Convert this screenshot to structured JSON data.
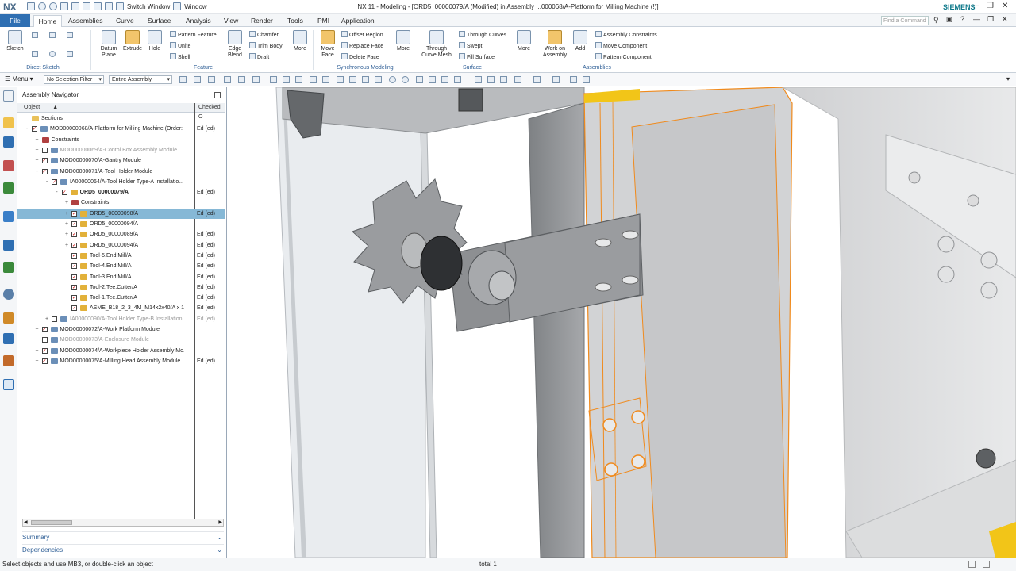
{
  "app": {
    "logo": "NX",
    "title": "NX 11 - Modeling - [ORD5_00000079/A (Modified)  in Assembly ...000068/A-Platform for Milling Machine  (!)]",
    "brand": "SIEMENS",
    "switch_window": "Switch Window",
    "window": "Window",
    "find_command_placeholder": "Find a Command"
  },
  "menu": {
    "tabs": [
      "File",
      "Home",
      "Assemblies",
      "Curve",
      "Surface",
      "Analysis",
      "View",
      "Render",
      "Tools",
      "PMI",
      "Application"
    ],
    "active": "Home"
  },
  "ribbon": {
    "direct_sketch": {
      "sketch": "Sketch",
      "label": "Direct Sketch"
    },
    "feature": {
      "datum_plane": "Datum Plane",
      "extrude": "Extrude",
      "hole": "Hole",
      "pattern_feature": "Pattern Feature",
      "unite": "Unite",
      "shell": "Shell",
      "edge_blend": "Edge Blend",
      "chamfer": "Chamfer",
      "trim_body": "Trim Body",
      "draft": "Draft",
      "more": "More",
      "label": "Feature"
    },
    "sync": {
      "move_face": "Move Face",
      "offset_region": "Offset Region",
      "replace_face": "Replace Face",
      "delete_face": "Delete Face",
      "more": "More",
      "label": "Synchronous Modeling"
    },
    "surface": {
      "through_curve_mesh": "Through Curve Mesh",
      "through_curves": "Through Curves",
      "swept": "Swept",
      "fill_surface": "Fill Surface",
      "more": "More",
      "label": "Surface"
    },
    "assemblies": {
      "work_on_assembly": "Work on Assembly",
      "add": "Add",
      "assembly_constraints": "Assembly Constraints",
      "move_component": "Move Component",
      "pattern_component": "Pattern Component",
      "label": "Assemblies"
    }
  },
  "selection_bar": {
    "menu": "Menu",
    "filter": "No Selection Filter",
    "scope": "Entire Assembly"
  },
  "navigator": {
    "title": "Assembly Navigator",
    "col_object": "Object",
    "col_checked": "Checked O",
    "rows": [
      {
        "label": "Sections",
        "level": 0,
        "exp": "",
        "cb": false,
        "icon": "folder",
        "checked": "",
        "dim": false,
        "bold": false
      },
      {
        "label": "MOD00000068/A-Platform for Milling Machine (Order: ...",
        "level": 0,
        "exp": "-",
        "cb": true,
        "icon": "asm",
        "checked": "Ed (ed)",
        "dim": false,
        "bold": false
      },
      {
        "label": "Constraints",
        "level": 1,
        "exp": "+",
        "cb": false,
        "icon": "constraint",
        "checked": "",
        "dim": false,
        "bold": false
      },
      {
        "label": "MOD00000069/A-Contol Box Assembly Module",
        "level": 1,
        "exp": "+",
        "cb": "empty",
        "icon": "asm",
        "checked": "",
        "dim": true,
        "bold": false
      },
      {
        "label": "MOD00000070/A-Gantry Module",
        "level": 1,
        "exp": "+",
        "cb": true,
        "icon": "asm",
        "checked": "",
        "dim": false,
        "bold": false
      },
      {
        "label": "MOD00000071/A-Tool Holder Module",
        "level": 1,
        "exp": "-",
        "cb": true,
        "icon": "asm",
        "checked": "",
        "dim": false,
        "bold": false
      },
      {
        "label": "IA00000064/A-Tool Holder Type-A Installatio...",
        "level": 2,
        "exp": "-",
        "cb": true,
        "icon": "asm",
        "checked": "",
        "dim": false,
        "bold": false
      },
      {
        "label": "ORD5_00000079/A",
        "level": 3,
        "exp": "-",
        "cb": true,
        "icon": "part",
        "checked": "Ed (ed)",
        "dim": false,
        "bold": true
      },
      {
        "label": "Constraints",
        "level": 4,
        "exp": "+",
        "cb": false,
        "icon": "constraint",
        "checked": "",
        "dim": false,
        "bold": false
      },
      {
        "label": "ORD5_00000098/A",
        "level": 4,
        "exp": "+",
        "cb": true,
        "icon": "part",
        "checked": "Ed (ed)",
        "dim": false,
        "bold": false,
        "sel": true
      },
      {
        "label": "ORD5_00000094/A",
        "level": 4,
        "exp": "+",
        "cb": true,
        "icon": "part",
        "checked": "",
        "dim": false,
        "bold": false
      },
      {
        "label": "ORD5_00000089/A",
        "level": 4,
        "exp": "+",
        "cb": true,
        "icon": "part",
        "checked": "Ed (ed)",
        "dim": false,
        "bold": false
      },
      {
        "label": "ORD5_00000094/A",
        "level": 4,
        "exp": "+",
        "cb": true,
        "icon": "part",
        "checked": "Ed (ed)",
        "dim": false,
        "bold": false
      },
      {
        "label": "Tool-5.End.Mill/A",
        "level": 4,
        "exp": "",
        "cb": true,
        "icon": "part",
        "checked": "Ed (ed)",
        "dim": false,
        "bold": false
      },
      {
        "label": "Tool-4.End.Mill/A",
        "level": 4,
        "exp": "",
        "cb": true,
        "icon": "part",
        "checked": "Ed (ed)",
        "dim": false,
        "bold": false
      },
      {
        "label": "Tool-3.End.Mill/A",
        "level": 4,
        "exp": "",
        "cb": true,
        "icon": "part",
        "checked": "Ed (ed)",
        "dim": false,
        "bold": false
      },
      {
        "label": "Tool-2.Tee.Cutter/A",
        "level": 4,
        "exp": "",
        "cb": true,
        "icon": "part",
        "checked": "Ed (ed)",
        "dim": false,
        "bold": false
      },
      {
        "label": "Tool-1.Tee.Cutter/A",
        "level": 4,
        "exp": "",
        "cb": true,
        "icon": "part",
        "checked": "Ed (ed)",
        "dim": false,
        "bold": false
      },
      {
        "label": "ASME_B18_2_3_4M_M14x2x40/A x 12",
        "level": 4,
        "exp": "",
        "cb": true,
        "icon": "part",
        "checked": "Ed (ed)",
        "dim": false,
        "bold": false
      },
      {
        "label": "IA00000090/A-Tool Holder Type-B Installation...",
        "level": 2,
        "exp": "+",
        "cb": "empty",
        "icon": "asm",
        "checked": "Ed (ed)",
        "dim": true,
        "bold": false
      },
      {
        "label": "MOD00000072/A-Work Platform Module",
        "level": 1,
        "exp": "+",
        "cb": true,
        "icon": "asm",
        "checked": "",
        "dim": false,
        "bold": false
      },
      {
        "label": "MOD00000073/A-Enclosure Module",
        "level": 1,
        "exp": "+",
        "cb": "empty",
        "icon": "asm",
        "checked": "",
        "dim": true,
        "bold": false
      },
      {
        "label": "MOD00000074/A-Workpiece Holder Assembly Mo...",
        "level": 1,
        "exp": "+",
        "cb": true,
        "icon": "asm",
        "checked": "",
        "dim": false,
        "bold": false
      },
      {
        "label": "MOD00000075/A-Milling Head Assembly Module",
        "level": 1,
        "exp": "+",
        "cb": true,
        "icon": "asm",
        "checked": "Ed (ed)",
        "dim": false,
        "bold": false
      }
    ],
    "summary": "Summary",
    "dependencies": "Dependencies"
  },
  "status": {
    "left": "Select objects and use MB3, or double-click an object",
    "center": "total 1"
  },
  "colors": {
    "accent": "#2f6fb2",
    "selection": "#86b8d6",
    "highlight": "#f08a1c",
    "part_gray": "#8d8f92"
  }
}
